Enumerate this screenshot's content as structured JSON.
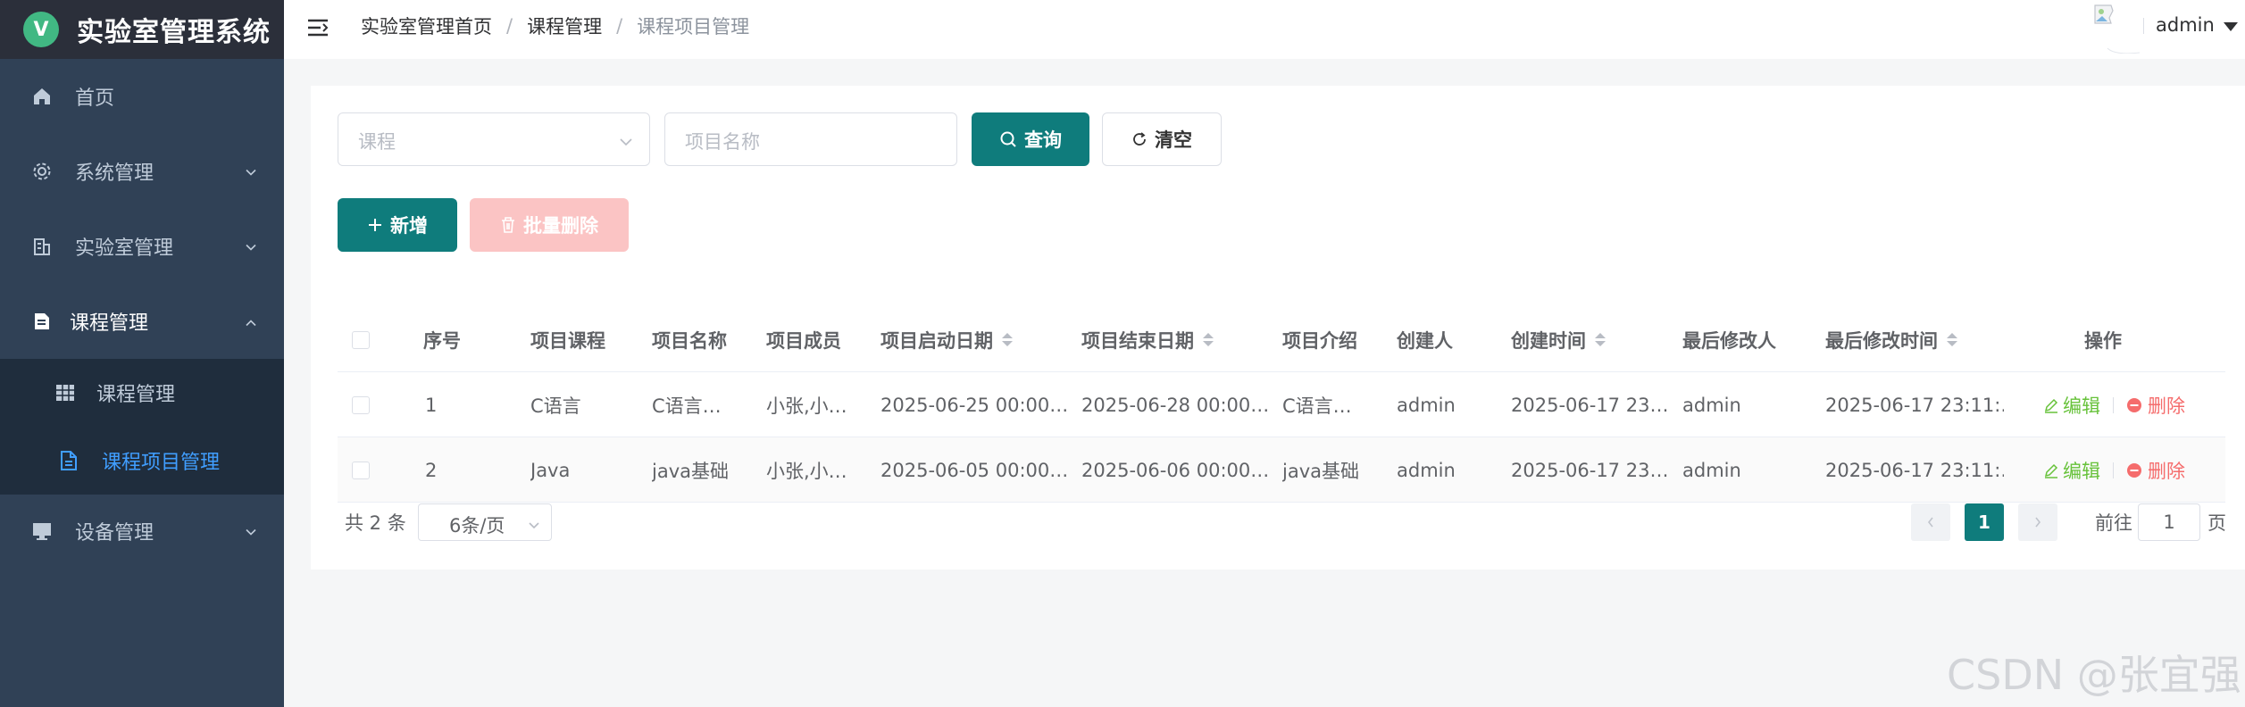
{
  "app": {
    "title": "实验室管理系统",
    "logo_letter": "V",
    "accent_color": "#0f7c7c",
    "sidebar_color": "#304156"
  },
  "sidebar": {
    "items": [
      {
        "label": "首页",
        "icon": "home-icon"
      },
      {
        "label": "系统管理",
        "icon": "gear-icon",
        "expandable": true
      },
      {
        "label": "实验室管理",
        "icon": "building-icon",
        "expandable": true
      },
      {
        "label": "课程管理",
        "icon": "document-icon",
        "expandable": true,
        "expanded": true,
        "children": [
          {
            "label": "课程管理",
            "icon": "grid-icon"
          },
          {
            "label": "课程项目管理",
            "icon": "file-text-icon",
            "active": true
          }
        ]
      },
      {
        "label": "设备管理",
        "icon": "monitor-icon",
        "expandable": true
      }
    ]
  },
  "header": {
    "breadcrumb": [
      "实验室管理首页",
      "课程管理",
      "课程项目管理"
    ],
    "separator": "/",
    "user": "admin"
  },
  "search": {
    "course_placeholder": "课程",
    "name_placeholder": "项目名称",
    "query_label": "查询",
    "clear_label": "清空"
  },
  "toolbar": {
    "add_label": "新增",
    "batch_delete_label": "批量删除"
  },
  "table": {
    "headers": {
      "index": "序号",
      "course": "项目课程",
      "name": "项目名称",
      "members": "项目成员",
      "start": "项目启动日期",
      "end": "项目结束日期",
      "intro": "项目介绍",
      "creator": "创建人",
      "created": "创建时间",
      "modifier": "最后修改人",
      "modified": "最后修改时间",
      "actions": "操作"
    },
    "rows": [
      {
        "index": "1",
        "course": "C语言",
        "name": "C语言…",
        "members": "小张,小…",
        "start": "2025-06-25 00:00…",
        "end": "2025-06-28 00:00…",
        "intro": "C语言…",
        "creator": "admin",
        "created": "2025-06-17 23…",
        "modifier": "admin",
        "modified": "2025-06-17 23:11:…",
        "edit": "编辑",
        "delete": "删除"
      },
      {
        "index": "2",
        "course": "Java",
        "name": "java基础",
        "members": "小张,小…",
        "start": "2025-06-05 00:00…",
        "end": "2025-06-06 00:00…",
        "intro": "java基础",
        "creator": "admin",
        "created": "2025-06-17 23…",
        "modifier": "admin",
        "modified": "2025-06-17 23:11:…",
        "edit": "编辑",
        "delete": "删除"
      }
    ]
  },
  "pagination": {
    "total_text": "共 2 条",
    "page_size": "6条/页",
    "current_page": "1",
    "goto_prefix": "前往",
    "goto_value": "1",
    "goto_suffix": "页"
  },
  "watermark": "CSDN @张宜强"
}
